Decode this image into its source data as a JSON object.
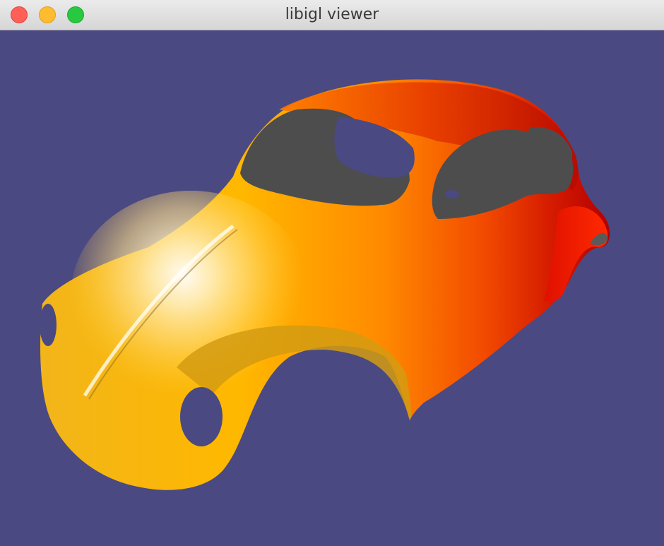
{
  "window": {
    "title": "libigl viewer",
    "controls": {
      "close_icon": "close-icon",
      "minimize_icon": "minimize-icon",
      "zoom_icon": "zoom-icon"
    }
  },
  "viewport": {
    "background_color": "#4b4981",
    "model": "car-body-mesh",
    "colormap": [
      "#fff3c4",
      "#ffd24a",
      "#ffa600",
      "#ff6200",
      "#d70800"
    ]
  }
}
